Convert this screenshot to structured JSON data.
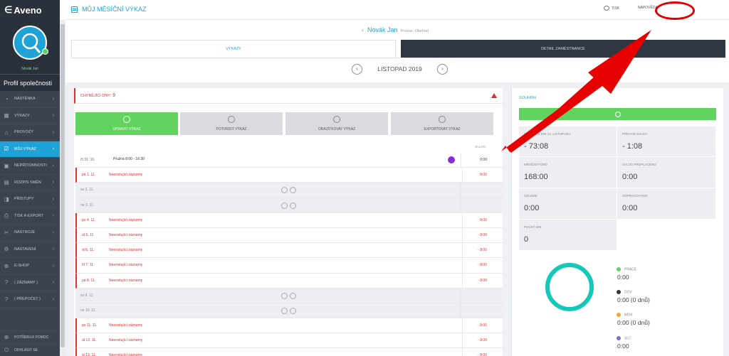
{
  "app": {
    "logo_text": "Aveno",
    "logo_symbol": "∈"
  },
  "profile": {
    "user_name": "Novák Jan",
    "company_label": "Profil společnosti"
  },
  "sidebar": {
    "items": [
      {
        "label": "NÁSTĚNKA",
        "icon": "dashboard-icon",
        "glyph": "◔"
      },
      {
        "label": "VÝKAZY",
        "icon": "calendar-icon",
        "glyph": "▦"
      },
      {
        "label": "PROVOZY",
        "icon": "store-icon",
        "glyph": "⌂"
      },
      {
        "label": "MŮJ VÝKAZ",
        "icon": "calendar-check-icon",
        "glyph": "☑"
      },
      {
        "label": "NEPŘÍTOMNOSTI",
        "icon": "absence-icon",
        "glyph": "▣"
      },
      {
        "label": "ROZPIS SMĚN",
        "icon": "shift-plan-icon",
        "glyph": "▤"
      },
      {
        "label": "PŘÍSTUPY",
        "icon": "door-icon",
        "glyph": "◨"
      },
      {
        "label": "TISK A EXPORT",
        "icon": "printer-icon",
        "glyph": "⎙"
      },
      {
        "label": "NÁSTROJE",
        "icon": "tools-icon",
        "glyph": "✂"
      },
      {
        "label": "NASTAVENÍ",
        "icon": "gear-icon",
        "glyph": "⚙"
      },
      {
        "label": "E-SHOP",
        "icon": "cart-icon",
        "glyph": "⊕"
      },
      {
        "label": "( ZÁZNAMY )",
        "icon": "help-icon",
        "glyph": "?"
      },
      {
        "label": "( PŘEPOČET )",
        "icon": "help-icon",
        "glyph": "?"
      }
    ],
    "active_index": 3,
    "bottom": [
      {
        "label": "POTŘEBUJI POMOC",
        "icon": "globe-icon",
        "glyph": "⊕"
      },
      {
        "label": "ODHLÁSIT SE",
        "icon": "power-icon",
        "glyph": "⏻"
      }
    ]
  },
  "header": {
    "title": "MŮJ MĚSÍČNÍ VÝKAZ",
    "print_label": "TISK",
    "help_label": "NÁPOVĚDA"
  },
  "employee": {
    "back": "‹",
    "name": "Novák Jan",
    "subtitle": "Provoz: Obchod"
  },
  "tabs": [
    {
      "label": "VÝKAZY"
    },
    {
      "label": "DETAIL ZAMĚSTNANCE"
    }
  ],
  "month": {
    "label": "LISTOPAD 2019",
    "prev": "‹",
    "next": "›"
  },
  "missing_days": {
    "label": "CHYBĚJÍCÍ DNY:",
    "count": "9"
  },
  "actions": [
    {
      "label": "UPRAVIT VÝKAZ"
    },
    {
      "label": "POTVRDIT VÝKAZ"
    },
    {
      "label": "ORAZÍTKOVAT VÝKAZ"
    },
    {
      "label": "EXPORTOVAT VÝKAZ"
    }
  ],
  "table": {
    "saldo_header": "SALDO",
    "rows": [
      {
        "date": "čt 31. 10.",
        "shift": "Pružná 8:00 - 16:30",
        "note": "",
        "saldo": "0:00",
        "type": "ok"
      },
      {
        "date": "pá 1. 11.",
        "shift": "",
        "note": "Neexistující záznamy",
        "saldo": "- 8:00",
        "type": "err"
      },
      {
        "date": "so 2. 11.",
        "shift": "",
        "note": "",
        "saldo": "",
        "type": "weekend"
      },
      {
        "date": "ne 3. 11.",
        "shift": "",
        "note": "",
        "saldo": "",
        "type": "weekend"
      },
      {
        "date": "po 4. 11.",
        "shift": "",
        "note": "Neexistující záznamy",
        "saldo": "- 8:00",
        "type": "err"
      },
      {
        "date": "út 5. 11.",
        "shift": "",
        "note": "Neexistující záznamy",
        "saldo": "- 8:00",
        "type": "err"
      },
      {
        "date": "st 6. 11.",
        "shift": "",
        "note": "Neexistující záznamy",
        "saldo": "- 8:00",
        "type": "err"
      },
      {
        "date": "čt 7. 11.",
        "shift": "",
        "note": "Neexistující záznamy",
        "saldo": "- 8:00",
        "type": "err"
      },
      {
        "date": "pá 8. 11.",
        "shift": "",
        "note": "Neexistující záznamy",
        "saldo": "- 8:00",
        "type": "err"
      },
      {
        "date": "so 9. 11.",
        "shift": "",
        "note": "",
        "saldo": "",
        "type": "weekend"
      },
      {
        "date": "ne 10. 11.",
        "shift": "",
        "note": "",
        "saldo": "",
        "type": "weekend"
      },
      {
        "date": "po 11. 11.",
        "shift": "",
        "note": "Neexistující záznamy",
        "saldo": "- 8:00",
        "type": "err"
      },
      {
        "date": "út 12. 11.",
        "shift": "",
        "note": "Neexistující záznamy",
        "saldo": "- 8:00",
        "type": "err"
      },
      {
        "date": "st 13. 11.",
        "shift": "",
        "note": "Neexistující záznamy",
        "saldo": "- 8:00",
        "type": "err"
      }
    ]
  },
  "summary": {
    "title": "SOUHRN",
    "stats": [
      {
        "label": "SALDO KE DNI 14. LISTOPADU",
        "value": "- 73:08"
      },
      {
        "label": "PŘEVOD SALDA",
        "value": "- 1:08"
      },
      {
        "label": "MĚSÍČNÍ FOND",
        "value": "168:00"
      },
      {
        "label": "SALDO PROPLACENO",
        "value": "0:00"
      },
      {
        "label": "CELKEM",
        "value": "0:00"
      },
      {
        "label": "ODPRACOVÁNO",
        "value": "0:00"
      },
      {
        "label": "POČET DNÍ",
        "value": "0"
      }
    ],
    "legend": [
      {
        "label": "PRÁCE",
        "value": "0:00",
        "color": "#62d35f"
      },
      {
        "label": "DOV",
        "value": "0:00 (0 dnů)",
        "color": "#2f3642"
      },
      {
        "label": "NEM",
        "value": "0:00 (0 dnů)",
        "color": "#f5a623"
      },
      {
        "label": "SLC",
        "value": "0:00",
        "color": "#7b6fd6"
      }
    ]
  },
  "colors": {
    "accent": "#1fa3d6",
    "success": "#62d35f",
    "error": "#e03030",
    "sidebar": "#3b4350",
    "ring": "#14c7b8"
  }
}
